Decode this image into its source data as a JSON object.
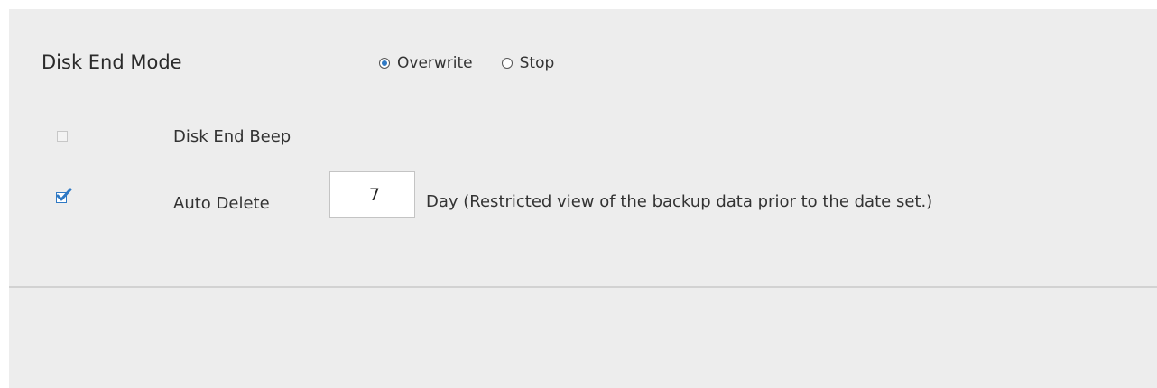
{
  "disk_end_mode": {
    "label": "Disk End Mode",
    "options": [
      {
        "label": "Overwrite",
        "selected": true
      },
      {
        "label": "Stop",
        "selected": false
      }
    ]
  },
  "disk_end_beep": {
    "label": "Disk End Beep",
    "checked": false
  },
  "auto_delete": {
    "label": "Auto Delete",
    "checked": true,
    "value": "7",
    "unit_note": "Day (Restricted view of the backup data prior to the date set.)"
  },
  "colors": {
    "accent": "#2f79c4",
    "panel_background": "#ededed",
    "divider": "#d2d2d2"
  }
}
